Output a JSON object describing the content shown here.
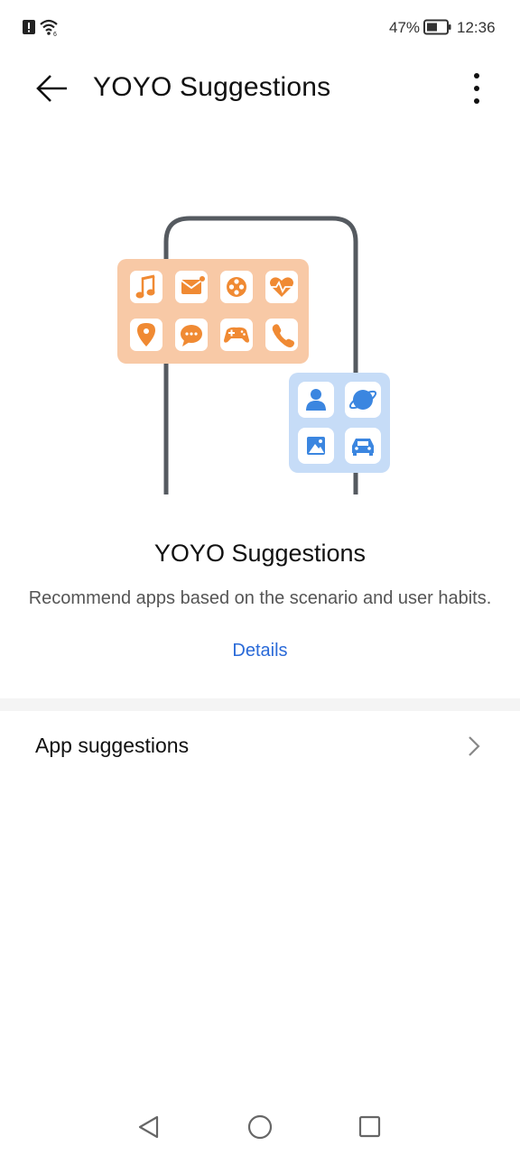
{
  "status_bar": {
    "battery_percent": "47%",
    "time": "12:36",
    "icons": [
      "alert-icon",
      "wifi-icon",
      "battery-icon"
    ]
  },
  "header": {
    "title": "YOYO Suggestions",
    "back_icon": "arrow-left-icon",
    "menu_icon": "more-vertical-icon"
  },
  "illustration": {
    "orange_panel_color": "#f8c9a6",
    "blue_panel_color": "#c6dcf7",
    "orange_icon_color": "#f08a33",
    "blue_icon_color": "#3b86e0",
    "orange_icons": [
      "music-note-icon",
      "mail-icon",
      "film-reel-icon",
      "heart-rate-icon",
      "location-pin-icon",
      "chat-bubble-icon",
      "gamepad-icon",
      "phone-icon"
    ],
    "blue_icons": [
      "person-icon",
      "globe-icon",
      "image-icon",
      "car-icon"
    ]
  },
  "hero": {
    "title": "YOYO Suggestions",
    "description": "Recommend apps based on the scenario and user habits.",
    "details_link": "Details",
    "link_color": "#2a6ad8"
  },
  "settings": {
    "items": [
      {
        "label": "App suggestions",
        "icon": "chevron-right-icon"
      }
    ]
  },
  "nav_bar": {
    "buttons": [
      "back-triangle-icon",
      "home-circle-icon",
      "recents-square-icon"
    ]
  }
}
